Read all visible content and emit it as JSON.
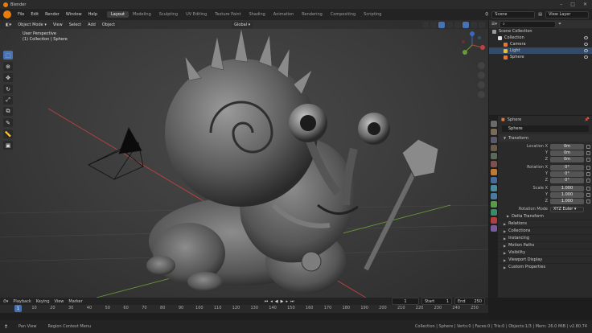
{
  "window": {
    "title": "Blender"
  },
  "menus": [
    "File",
    "Edit",
    "Render",
    "Window",
    "Help"
  ],
  "workspaces": [
    {
      "label": "Layout",
      "active": true
    },
    {
      "label": "Modeling"
    },
    {
      "label": "Sculpting"
    },
    {
      "label": "UV Editing"
    },
    {
      "label": "Texture Paint"
    },
    {
      "label": "Shading"
    },
    {
      "label": "Animation"
    },
    {
      "label": "Rendering"
    },
    {
      "label": "Compositing"
    },
    {
      "label": "Scripting"
    }
  ],
  "top_right": {
    "scene": "Scene",
    "view_layer": "View Layer"
  },
  "viewport": {
    "mode": "Object Mode",
    "menus": [
      "View",
      "Select",
      "Add",
      "Object"
    ],
    "orientation": "Global",
    "overlay_line1": "User Perspective",
    "overlay_line2": "(1) Collection | Sphere"
  },
  "tools": [
    "select",
    "cursor",
    "move",
    "rotate",
    "scale",
    "transform",
    "annotate",
    "measure",
    "add-cube"
  ],
  "timeline": {
    "menus": [
      "Playback",
      "Keying",
      "View",
      "Marker"
    ],
    "current_frame": "1",
    "start_label": "Start",
    "start": "1",
    "end_label": "End",
    "end": "250",
    "ticks": [
      "1",
      "10",
      "20",
      "30",
      "40",
      "50",
      "60",
      "70",
      "80",
      "90",
      "100",
      "110",
      "120",
      "130",
      "140",
      "150",
      "160",
      "170",
      "180",
      "190",
      "200",
      "210",
      "220",
      "230",
      "240",
      "250"
    ]
  },
  "status": {
    "pan": "Pan View",
    "context": "Region Context Menu",
    "stats": "Collection | Sphere | Verts:0 | Faces:0 | Tris:0 | Objects:1/3 | Mem: 26.0 MiB | v2.80.74"
  },
  "outliner": {
    "rows": [
      {
        "label": "Scene Collection",
        "indent": 0,
        "color": "#9a9a9a"
      },
      {
        "label": "Collection",
        "indent": 1,
        "color": "#e0e0e0"
      },
      {
        "label": "Camera",
        "indent": 2,
        "color": "#e07a3a"
      },
      {
        "label": "Light",
        "indent": 2,
        "color": "#e0c040",
        "selected": true
      },
      {
        "label": "Sphere",
        "indent": 2,
        "color": "#e07a3a"
      }
    ]
  },
  "properties": {
    "object_name": "Sphere",
    "header_name": "Sphere",
    "transform_title": "Transform",
    "location": [
      {
        "label": "Location X",
        "value": "0m"
      },
      {
        "label": "Y",
        "value": "0m"
      },
      {
        "label": "Z",
        "value": "0m"
      }
    ],
    "rotation": [
      {
        "label": "Rotation X",
        "value": "0°"
      },
      {
        "label": "Y",
        "value": "0°"
      },
      {
        "label": "Z",
        "value": "0°"
      }
    ],
    "scale": [
      {
        "label": "Scale X",
        "value": "1.000"
      },
      {
        "label": "Y",
        "value": "1.000"
      },
      {
        "label": "Z",
        "value": "1.000"
      }
    ],
    "rotation_mode_label": "Rotation Mode",
    "rotation_mode": "XYZ Euler",
    "delta": "Delta Transform",
    "panels": [
      "Relations",
      "Collections",
      "Instancing",
      "Motion Paths",
      "Visibility",
      "Viewport Display",
      "Custom Properties"
    ]
  },
  "colors": {
    "accent": "#4772b3",
    "brand": "#e87d0d"
  }
}
